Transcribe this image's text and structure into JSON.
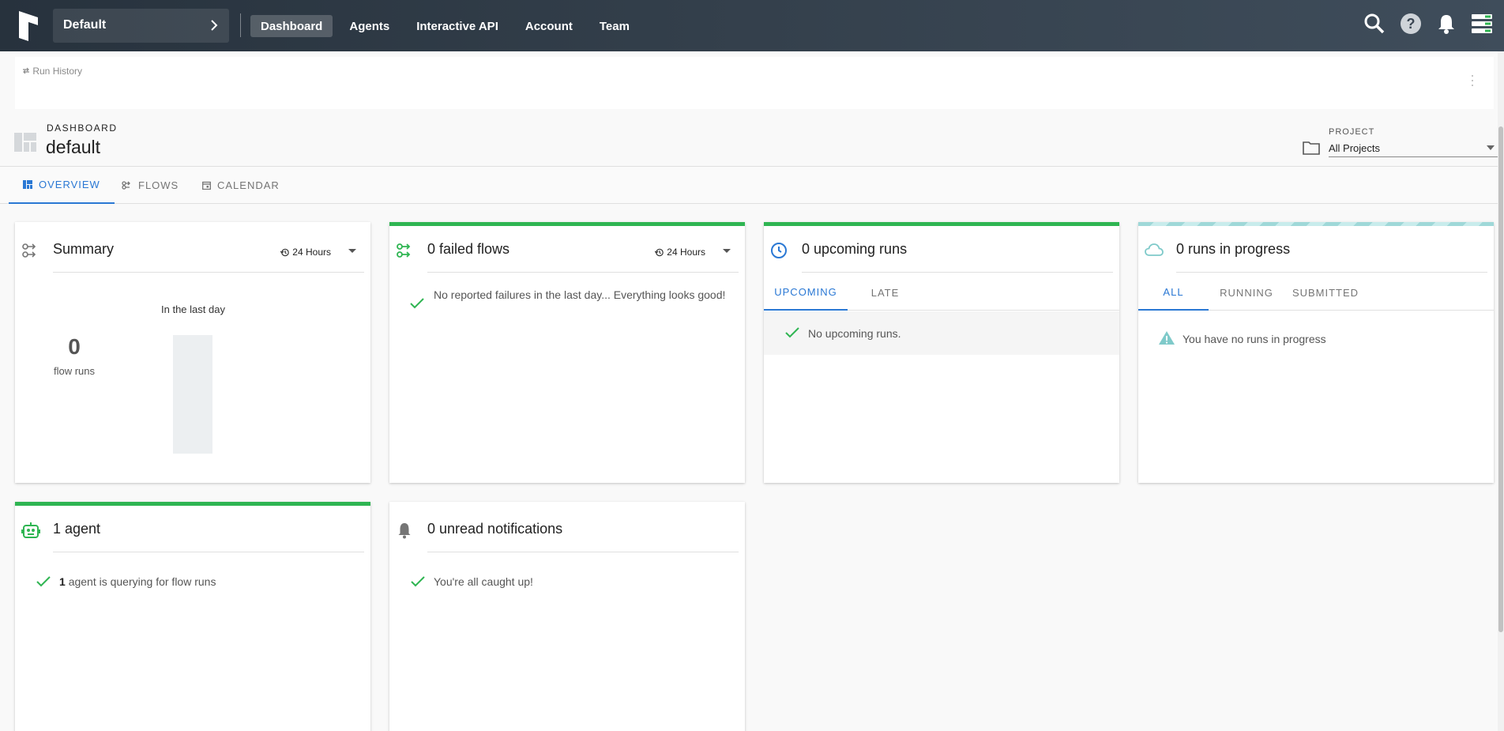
{
  "topbar": {
    "team": "Default",
    "nav": [
      "Dashboard",
      "Agents",
      "Interactive API",
      "Account",
      "Team"
    ],
    "active_nav": "Dashboard",
    "icons": [
      "search-icon",
      "help-icon",
      "bell-icon",
      "server-status-icon"
    ]
  },
  "run_history": {
    "label": "Run History"
  },
  "dashboard": {
    "overline": "DASHBOARD",
    "name": "default"
  },
  "project": {
    "label": "PROJECT",
    "value": "All Projects"
  },
  "tabs": [
    "OVERVIEW",
    "FLOWS",
    "CALENDAR"
  ],
  "summary": {
    "title": "Summary",
    "period": "24 Hours",
    "caption": "In the last day",
    "count": "0",
    "count_label": "flow runs"
  },
  "failed": {
    "title": "0 failed flows",
    "period": "24 Hours",
    "message": "No reported failures in the last day... Everything looks good!"
  },
  "upcoming": {
    "title": "0 upcoming runs",
    "tabs": [
      "UPCOMING",
      "LATE"
    ],
    "message": "No upcoming runs."
  },
  "in_progress": {
    "title": "0 runs in progress",
    "tabs": [
      "ALL",
      "RUNNING",
      "SUBMITTED"
    ],
    "message": "You have no runs in progress"
  },
  "agents": {
    "title": "1 agent",
    "count": "1",
    "message": "agent is querying for flow runs"
  },
  "notifications": {
    "title": "0 unread notifications",
    "message": "You're all caught up!"
  },
  "colors": {
    "accent": "#2a78d4",
    "success": "#2fb552",
    "topbar": "#27323d"
  }
}
